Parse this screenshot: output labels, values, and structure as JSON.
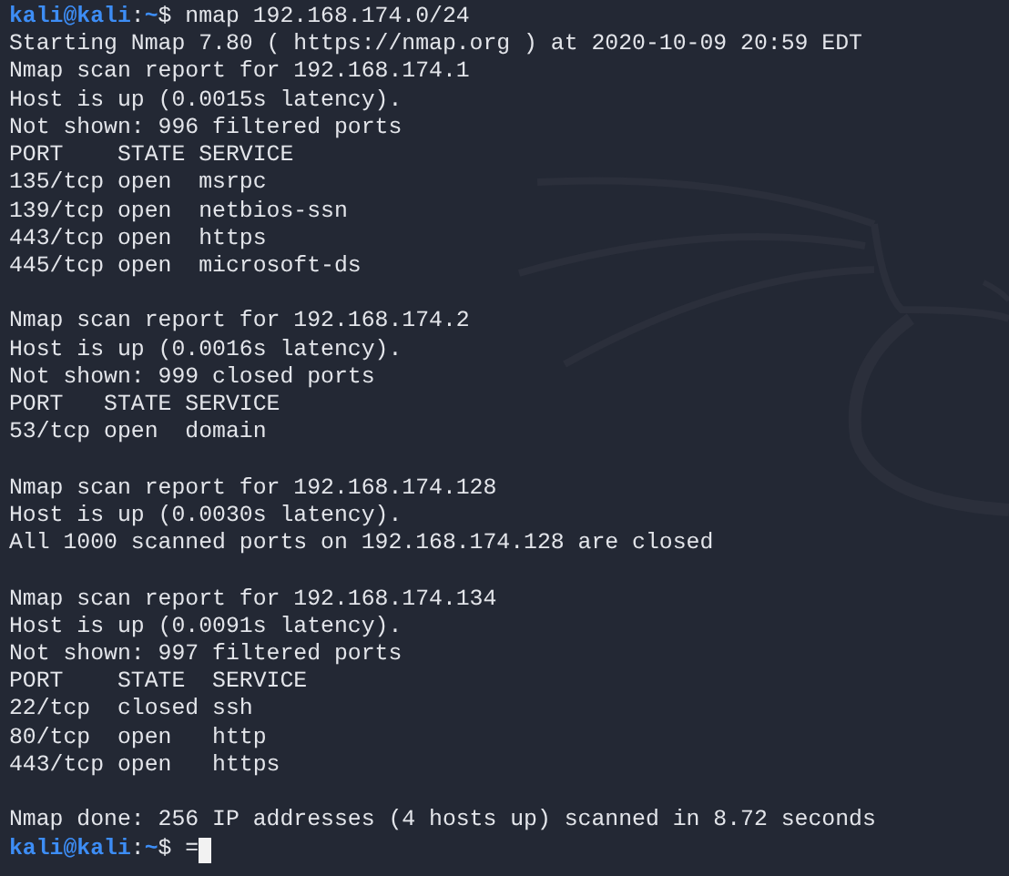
{
  "terminal": {
    "lines": [
      {
        "kind": "prompt",
        "user_host": "kali@kali",
        "colon": ":",
        "path": "~",
        "symbol": "$",
        "command": "nmap 192.168.174.0/24",
        "cursor": false
      },
      {
        "kind": "output",
        "text": "Starting Nmap 7.80 ( https://nmap.org ) at 2020-10-09 20:59 EDT"
      },
      {
        "kind": "output",
        "text": "Nmap scan report for 192.168.174.1"
      },
      {
        "kind": "output",
        "text": "Host is up (0.0015s latency)."
      },
      {
        "kind": "output",
        "text": "Not shown: 996 filtered ports"
      },
      {
        "kind": "output",
        "text": "PORT    STATE SERVICE"
      },
      {
        "kind": "output",
        "text": "135/tcp open  msrpc"
      },
      {
        "kind": "output",
        "text": "139/tcp open  netbios-ssn"
      },
      {
        "kind": "output",
        "text": "443/tcp open  https"
      },
      {
        "kind": "output",
        "text": "445/tcp open  microsoft-ds"
      },
      {
        "kind": "blank"
      },
      {
        "kind": "output",
        "text": "Nmap scan report for 192.168.174.2"
      },
      {
        "kind": "output",
        "text": "Host is up (0.0016s latency)."
      },
      {
        "kind": "output",
        "text": "Not shown: 999 closed ports"
      },
      {
        "kind": "output",
        "text": "PORT   STATE SERVICE"
      },
      {
        "kind": "output",
        "text": "53/tcp open  domain"
      },
      {
        "kind": "blank"
      },
      {
        "kind": "output",
        "text": "Nmap scan report for 192.168.174.128"
      },
      {
        "kind": "output",
        "text": "Host is up (0.0030s latency)."
      },
      {
        "kind": "output",
        "text": "All 1000 scanned ports on 192.168.174.128 are closed"
      },
      {
        "kind": "blank"
      },
      {
        "kind": "output",
        "text": "Nmap scan report for 192.168.174.134"
      },
      {
        "kind": "output",
        "text": "Host is up (0.0091s latency)."
      },
      {
        "kind": "output",
        "text": "Not shown: 997 filtered ports"
      },
      {
        "kind": "output",
        "text": "PORT    STATE  SERVICE"
      },
      {
        "kind": "output",
        "text": "22/tcp  closed ssh"
      },
      {
        "kind": "output",
        "text": "80/tcp  open   http"
      },
      {
        "kind": "output",
        "text": "443/tcp open   https"
      },
      {
        "kind": "blank"
      },
      {
        "kind": "output",
        "text": "Nmap done: 256 IP addresses (4 hosts up) scanned in 8.72 seconds"
      },
      {
        "kind": "prompt",
        "user_host": "kali@kali",
        "colon": ":",
        "path": "~",
        "symbol": "$",
        "command": "=",
        "cursor": true
      }
    ]
  }
}
